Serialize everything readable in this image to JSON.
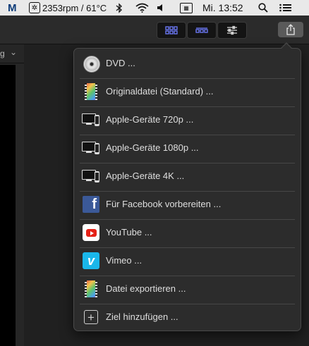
{
  "menubar": {
    "logo": "M",
    "fan_text": "2353rpm / 61°C",
    "time": "Mi. 13:52"
  },
  "toolbar": {
    "buttons": [
      {
        "name": "browser-view-button",
        "icon": "grid-icon"
      },
      {
        "name": "timeline-view-button",
        "icon": "filmstrip-icon"
      },
      {
        "name": "inspector-button",
        "icon": "sliders-icon"
      }
    ],
    "share_icon": "share-icon"
  },
  "left_panel": {
    "header_fragment": "g"
  },
  "share_menu": {
    "items": [
      {
        "label": "DVD ...",
        "icon": "dvd-icon"
      },
      {
        "label": "Originaldatei (Standard) ...",
        "icon": "film-icon"
      },
      {
        "label": "Apple-Geräte 720p ...",
        "icon": "apple-devices-icon"
      },
      {
        "label": "Apple-Geräte 1080p ...",
        "icon": "apple-devices-icon"
      },
      {
        "label": "Apple-Geräte 4K ...",
        "icon": "apple-devices-icon"
      },
      {
        "label": "Für Facebook vorbereiten ...",
        "icon": "facebook-icon"
      },
      {
        "label": "YouTube ...",
        "icon": "youtube-icon"
      },
      {
        "label": "Vimeo ...",
        "icon": "vimeo-icon"
      },
      {
        "label": "Datei exportieren ...",
        "icon": "film-icon"
      },
      {
        "label": "Ziel hinzufügen ...",
        "icon": "add-destination-icon"
      }
    ]
  },
  "colors": {
    "accent": "#6f7cff",
    "facebook": "#3b5998",
    "youtube": "#e62117",
    "vimeo": "#1ab7ea"
  }
}
